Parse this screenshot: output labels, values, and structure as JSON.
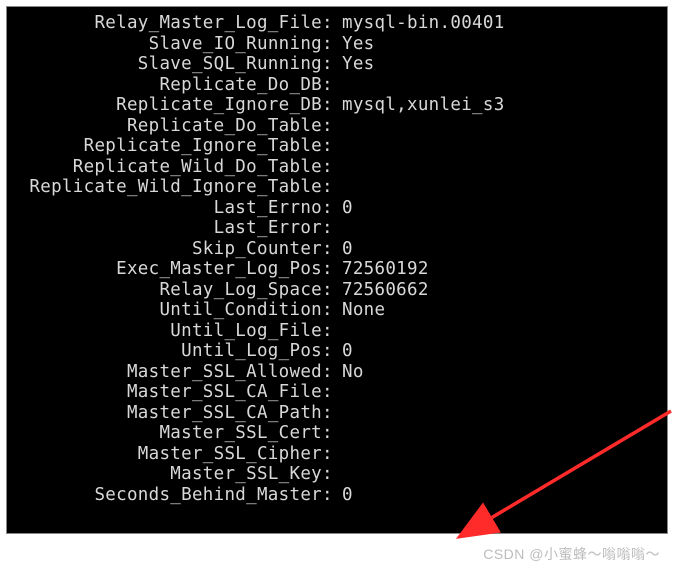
{
  "status": {
    "rows": [
      {
        "label": "Relay_Master_Log_File",
        "value": "mysql-bin.00401"
      },
      {
        "label": "Slave_IO_Running",
        "value": "Yes"
      },
      {
        "label": "Slave_SQL_Running",
        "value": "Yes"
      },
      {
        "label": "Replicate_Do_DB",
        "value": ""
      },
      {
        "label": "Replicate_Ignore_DB",
        "value": "mysql,xunlei_s3"
      },
      {
        "label": "Replicate_Do_Table",
        "value": ""
      },
      {
        "label": "Replicate_Ignore_Table",
        "value": ""
      },
      {
        "label": "Replicate_Wild_Do_Table",
        "value": ""
      },
      {
        "label": "Replicate_Wild_Ignore_Table",
        "value": ""
      },
      {
        "label": "Last_Errno",
        "value": "0"
      },
      {
        "label": "Last_Error",
        "value": ""
      },
      {
        "label": "Skip_Counter",
        "value": "0"
      },
      {
        "label": "Exec_Master_Log_Pos",
        "value": "72560192"
      },
      {
        "label": "Relay_Log_Space",
        "value": "72560662"
      },
      {
        "label": "Until_Condition",
        "value": "None"
      },
      {
        "label": "Until_Log_File",
        "value": ""
      },
      {
        "label": "Until_Log_Pos",
        "value": "0"
      },
      {
        "label": "Master_SSL_Allowed",
        "value": "No"
      },
      {
        "label": "Master_SSL_CA_File",
        "value": ""
      },
      {
        "label": "Master_SSL_CA_Path",
        "value": ""
      },
      {
        "label": "Master_SSL_Cert",
        "value": ""
      },
      {
        "label": "Master_SSL_Cipher",
        "value": ""
      },
      {
        "label": "Master_SSL_Key",
        "value": ""
      },
      {
        "label": "Seconds_Behind_Master",
        "value": "0"
      }
    ]
  },
  "watermark": "CSDN @小蜜蜂～嗡嗡嗡～",
  "arrow_color": "#ff2a2a"
}
